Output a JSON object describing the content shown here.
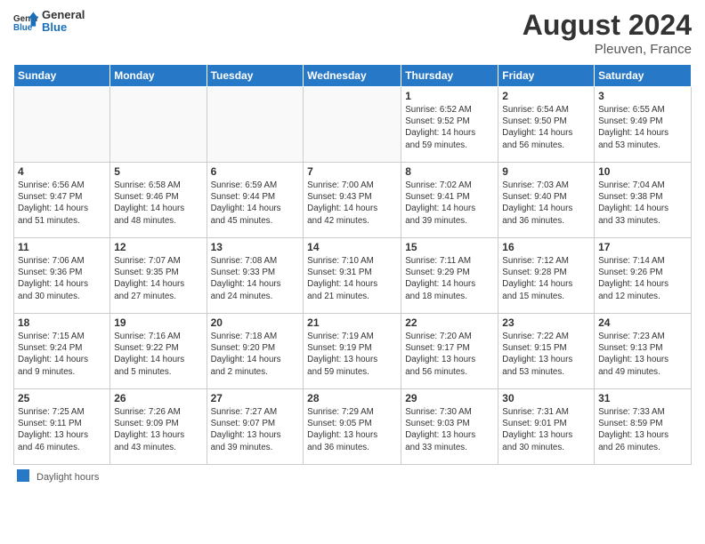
{
  "header": {
    "logo_general": "General",
    "logo_blue": "Blue",
    "month_year": "August 2024",
    "location": "Pleuven, France"
  },
  "days_of_week": [
    "Sunday",
    "Monday",
    "Tuesday",
    "Wednesday",
    "Thursday",
    "Friday",
    "Saturday"
  ],
  "weeks": [
    [
      {
        "day": "",
        "info": ""
      },
      {
        "day": "",
        "info": ""
      },
      {
        "day": "",
        "info": ""
      },
      {
        "day": "",
        "info": ""
      },
      {
        "day": "1",
        "info": "Sunrise: 6:52 AM\nSunset: 9:52 PM\nDaylight: 14 hours\nand 59 minutes."
      },
      {
        "day": "2",
        "info": "Sunrise: 6:54 AM\nSunset: 9:50 PM\nDaylight: 14 hours\nand 56 minutes."
      },
      {
        "day": "3",
        "info": "Sunrise: 6:55 AM\nSunset: 9:49 PM\nDaylight: 14 hours\nand 53 minutes."
      }
    ],
    [
      {
        "day": "4",
        "info": "Sunrise: 6:56 AM\nSunset: 9:47 PM\nDaylight: 14 hours\nand 51 minutes."
      },
      {
        "day": "5",
        "info": "Sunrise: 6:58 AM\nSunset: 9:46 PM\nDaylight: 14 hours\nand 48 minutes."
      },
      {
        "day": "6",
        "info": "Sunrise: 6:59 AM\nSunset: 9:44 PM\nDaylight: 14 hours\nand 45 minutes."
      },
      {
        "day": "7",
        "info": "Sunrise: 7:00 AM\nSunset: 9:43 PM\nDaylight: 14 hours\nand 42 minutes."
      },
      {
        "day": "8",
        "info": "Sunrise: 7:02 AM\nSunset: 9:41 PM\nDaylight: 14 hours\nand 39 minutes."
      },
      {
        "day": "9",
        "info": "Sunrise: 7:03 AM\nSunset: 9:40 PM\nDaylight: 14 hours\nand 36 minutes."
      },
      {
        "day": "10",
        "info": "Sunrise: 7:04 AM\nSunset: 9:38 PM\nDaylight: 14 hours\nand 33 minutes."
      }
    ],
    [
      {
        "day": "11",
        "info": "Sunrise: 7:06 AM\nSunset: 9:36 PM\nDaylight: 14 hours\nand 30 minutes."
      },
      {
        "day": "12",
        "info": "Sunrise: 7:07 AM\nSunset: 9:35 PM\nDaylight: 14 hours\nand 27 minutes."
      },
      {
        "day": "13",
        "info": "Sunrise: 7:08 AM\nSunset: 9:33 PM\nDaylight: 14 hours\nand 24 minutes."
      },
      {
        "day": "14",
        "info": "Sunrise: 7:10 AM\nSunset: 9:31 PM\nDaylight: 14 hours\nand 21 minutes."
      },
      {
        "day": "15",
        "info": "Sunrise: 7:11 AM\nSunset: 9:29 PM\nDaylight: 14 hours\nand 18 minutes."
      },
      {
        "day": "16",
        "info": "Sunrise: 7:12 AM\nSunset: 9:28 PM\nDaylight: 14 hours\nand 15 minutes."
      },
      {
        "day": "17",
        "info": "Sunrise: 7:14 AM\nSunset: 9:26 PM\nDaylight: 14 hours\nand 12 minutes."
      }
    ],
    [
      {
        "day": "18",
        "info": "Sunrise: 7:15 AM\nSunset: 9:24 PM\nDaylight: 14 hours\nand 9 minutes."
      },
      {
        "day": "19",
        "info": "Sunrise: 7:16 AM\nSunset: 9:22 PM\nDaylight: 14 hours\nand 5 minutes."
      },
      {
        "day": "20",
        "info": "Sunrise: 7:18 AM\nSunset: 9:20 PM\nDaylight: 14 hours\nand 2 minutes."
      },
      {
        "day": "21",
        "info": "Sunrise: 7:19 AM\nSunset: 9:19 PM\nDaylight: 13 hours\nand 59 minutes."
      },
      {
        "day": "22",
        "info": "Sunrise: 7:20 AM\nSunset: 9:17 PM\nDaylight: 13 hours\nand 56 minutes."
      },
      {
        "day": "23",
        "info": "Sunrise: 7:22 AM\nSunset: 9:15 PM\nDaylight: 13 hours\nand 53 minutes."
      },
      {
        "day": "24",
        "info": "Sunrise: 7:23 AM\nSunset: 9:13 PM\nDaylight: 13 hours\nand 49 minutes."
      }
    ],
    [
      {
        "day": "25",
        "info": "Sunrise: 7:25 AM\nSunset: 9:11 PM\nDaylight: 13 hours\nand 46 minutes."
      },
      {
        "day": "26",
        "info": "Sunrise: 7:26 AM\nSunset: 9:09 PM\nDaylight: 13 hours\nand 43 minutes."
      },
      {
        "day": "27",
        "info": "Sunrise: 7:27 AM\nSunset: 9:07 PM\nDaylight: 13 hours\nand 39 minutes."
      },
      {
        "day": "28",
        "info": "Sunrise: 7:29 AM\nSunset: 9:05 PM\nDaylight: 13 hours\nand 36 minutes."
      },
      {
        "day": "29",
        "info": "Sunrise: 7:30 AM\nSunset: 9:03 PM\nDaylight: 13 hours\nand 33 minutes."
      },
      {
        "day": "30",
        "info": "Sunrise: 7:31 AM\nSunset: 9:01 PM\nDaylight: 13 hours\nand 30 minutes."
      },
      {
        "day": "31",
        "info": "Sunrise: 7:33 AM\nSunset: 8:59 PM\nDaylight: 13 hours\nand 26 minutes."
      }
    ]
  ],
  "footer": {
    "daylight_label": "Daylight hours"
  }
}
